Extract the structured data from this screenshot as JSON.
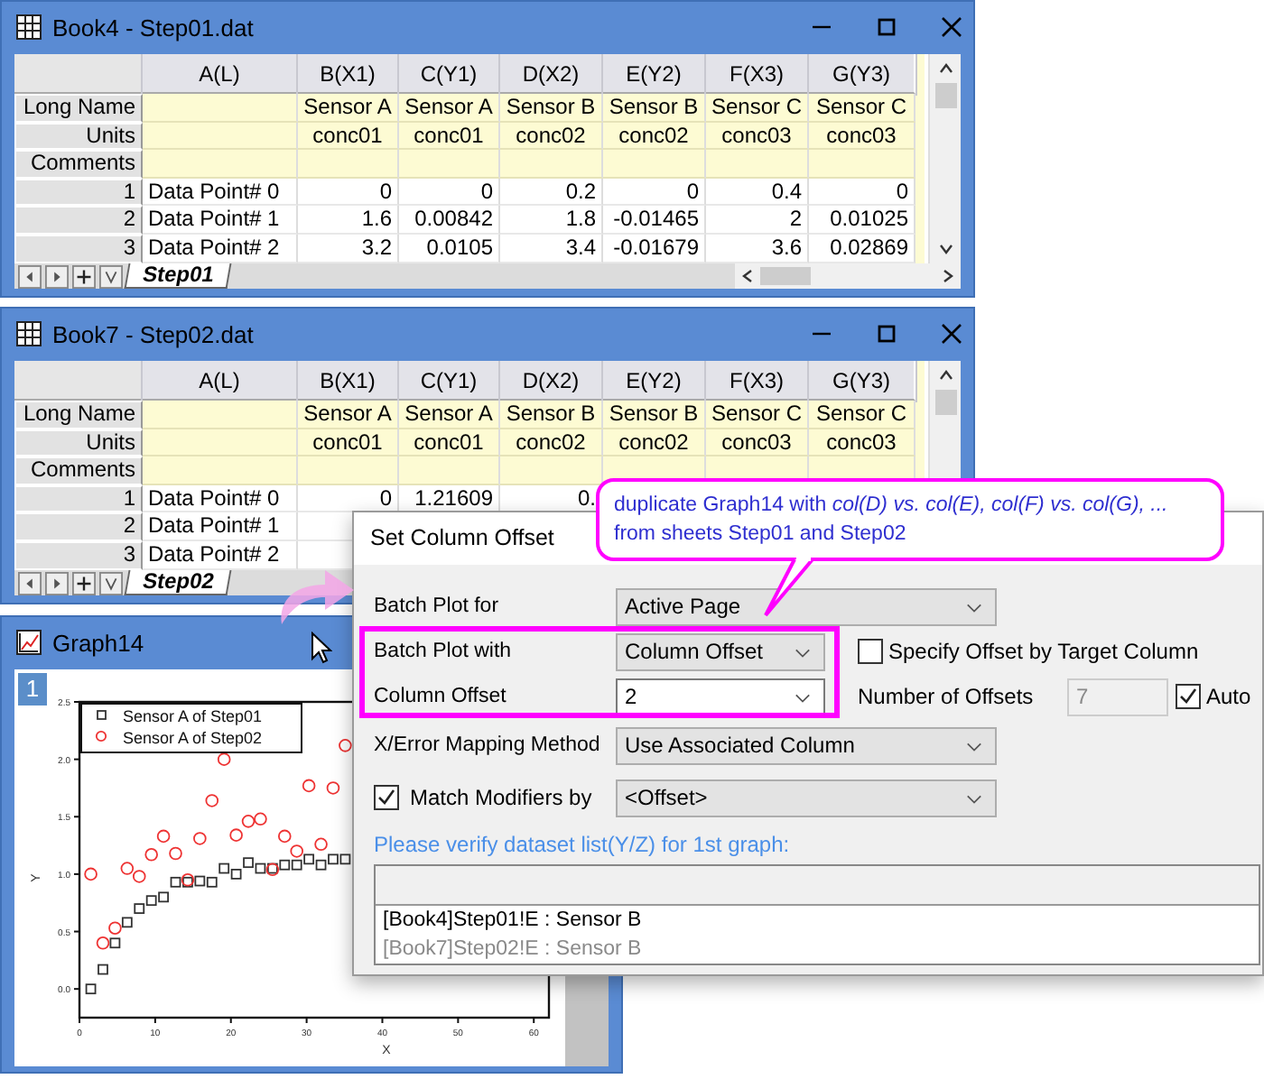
{
  "workbooks": [
    {
      "title": "Book4 - Step01.dat",
      "columns": [
        "A(L)",
        "B(X1)",
        "C(Y1)",
        "D(X2)",
        "E(Y2)",
        "F(X3)",
        "G(Y3)"
      ],
      "label_rows": [
        {
          "label": "Long Name",
          "cells": [
            "",
            "Sensor A",
            "Sensor A",
            "Sensor B",
            "Sensor B",
            "Sensor C",
            "Sensor C"
          ]
        },
        {
          "label": "Units",
          "cells": [
            "",
            "conc01",
            "conc01",
            "conc02",
            "conc02",
            "conc03",
            "conc03"
          ]
        },
        {
          "label": "Comments",
          "cells": []
        }
      ],
      "rows": [
        {
          "number": "1",
          "cells": [
            "Data Point# 0",
            "0",
            "0",
            "0.2",
            "0",
            "0.4",
            "0"
          ]
        },
        {
          "number": "2",
          "cells": [
            "Data Point# 1",
            "1.6",
            "0.00842",
            "1.8",
            "-0.01465",
            "2",
            "0.01025"
          ]
        },
        {
          "number": "3",
          "cells": [
            "Data Point# 2",
            "3.2",
            "0.0105",
            "3.4",
            "-0.01679",
            "3.6",
            "0.02869"
          ]
        }
      ],
      "sheet_tab": "Step01"
    },
    {
      "title": "Book7 - Step02.dat",
      "columns": [
        "A(L)",
        "B(X1)",
        "C(Y1)",
        "D(X2)",
        "E(Y2)",
        "F(X3)",
        "G(Y3)"
      ],
      "label_rows": [
        {
          "label": "Long Name",
          "cells": [
            "",
            "Sensor A",
            "Sensor A",
            "Sensor B",
            "Sensor B",
            "Sensor C",
            "Sensor C"
          ]
        },
        {
          "label": "Units",
          "cells": [
            "",
            "conc01",
            "conc01",
            "conc02",
            "conc02",
            "conc03",
            "conc03"
          ]
        },
        {
          "label": "Comments",
          "cells": []
        }
      ],
      "rows": [
        {
          "number": "1",
          "cells": [
            "Data Point# 0",
            "0",
            "1.21609",
            "0."
          ]
        },
        {
          "number": "2",
          "cells": [
            "Data Point# 1"
          ]
        },
        {
          "number": "3",
          "cells": [
            "Data Point# 2"
          ]
        }
      ],
      "sheet_tab": "Step02"
    }
  ],
  "graph": {
    "title": "Graph14",
    "page": "1",
    "chart_data": {
      "type": "scatter",
      "xlabel": "X",
      "ylabel": "Y",
      "x": [
        1.5,
        3.1,
        4.7,
        6.3,
        7.9,
        9.5,
        11.1,
        12.7,
        14.3,
        15.9,
        17.5,
        19.1,
        20.7,
        22.3,
        23.9,
        25.5,
        27.1,
        28.7,
        30.3,
        31.9,
        33.5,
        35.1
      ],
      "series": [
        {
          "name": "Sensor A of Step01",
          "color": "#333333",
          "marker": "square",
          "values": [
            0,
            0.17,
            0.4,
            0.58,
            0.7,
            0.77,
            0.8,
            0.93,
            0.93,
            0.94,
            0.93,
            1.05,
            1.0,
            1.1,
            1.05,
            1.05,
            1.08,
            1.08,
            1.13,
            1.08,
            1.13,
            1.13
          ]
        },
        {
          "name": "Sensor A of Step02",
          "color": "#ee3333",
          "marker": "circle",
          "values": [
            1.0,
            0.4,
            0.53,
            1.05,
            0.98,
            1.17,
            1.33,
            1.18,
            0.95,
            1.31,
            1.64,
            2.0,
            1.34,
            1.46,
            1.48,
            1.04,
            1.33,
            1.2,
            1.77,
            1.26,
            1.75,
            2.12
          ]
        }
      ],
      "legend": true,
      "xlim": [
        0,
        62
      ],
      "ylim": [
        -0.25,
        2.5
      ],
      "xticks": [
        0,
        10,
        20,
        30,
        40,
        50,
        60
      ],
      "yticks": [
        {
          "value": 0,
          "label": "0.0"
        },
        {
          "value": 0.5,
          "label": "0.5"
        },
        {
          "value": 1,
          "label": "1.0"
        },
        {
          "value": 1.5,
          "label": "1.5"
        },
        {
          "value": 2,
          "label": "2.0"
        },
        {
          "value": 2.5,
          "label": "2.5"
        }
      ]
    }
  },
  "callout": {
    "text": "duplicate Graph14 with *col(D) vs. col(E), col(F) vs. col(G), ...*\nfrom sheets Step01 and Step02"
  },
  "dialog": {
    "title": "Set Column Offset",
    "plot_for": {
      "label": "Batch Plot for",
      "value": "Active Page"
    },
    "plot_with": {
      "label": "Batch Plot with",
      "value": "Column Offset"
    },
    "column_offset": {
      "label": "Column Offset",
      "value": "2"
    },
    "specify_offset": {
      "label": "Specify Offset by Target Column",
      "checked": false
    },
    "number_of_offsets": {
      "label": "Number of Offsets",
      "value": "7",
      "disabled": true
    },
    "auto": {
      "label": "Auto",
      "checked": true
    },
    "mapping": {
      "label": "X/Error Mapping Method",
      "value": "Use Associated Column"
    },
    "match_modifiers": {
      "label": "Match Modifiers by",
      "checked": true,
      "value": "<Offset>"
    },
    "note": "Please verify dataset list(Y/Z) for 1st graph:",
    "datasets": [
      {
        "text": "[Book4]Step01!E : Sensor B",
        "dimmed": false
      },
      {
        "text": "[Book7]Step02!E : Sensor B",
        "dimmed": true
      }
    ]
  }
}
